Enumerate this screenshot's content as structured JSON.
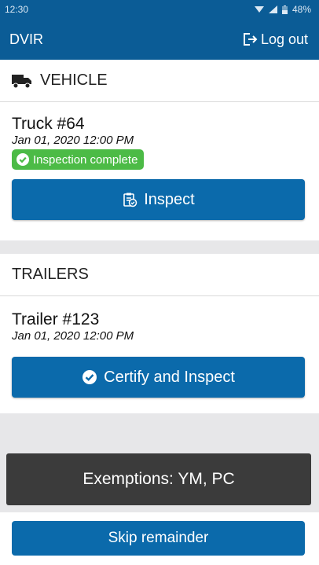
{
  "status_bar": {
    "time": "12:30",
    "battery": "48%"
  },
  "app_bar": {
    "title": "DVIR",
    "logout_label": "Log out"
  },
  "vehicle": {
    "section_title": "VEHICLE",
    "name": "Truck #64",
    "date": "Jan 01, 2020 12:00 PM",
    "status_badge": "Inspection complete",
    "inspect_button": "Inspect"
  },
  "trailers": {
    "section_title": "TRAILERS",
    "name": "Trailer #123",
    "date": "Jan 01, 2020 12:00 PM",
    "certify_button": "Certify and Inspect"
  },
  "exemptions": {
    "label": "Exemptions: YM, PC"
  },
  "footer": {
    "skip_button": "Skip remainder"
  },
  "colors": {
    "primary": "#0b5c96",
    "button": "#0b6aab",
    "success": "#4cbb46",
    "exemptions_bg": "#3b3b3b"
  }
}
